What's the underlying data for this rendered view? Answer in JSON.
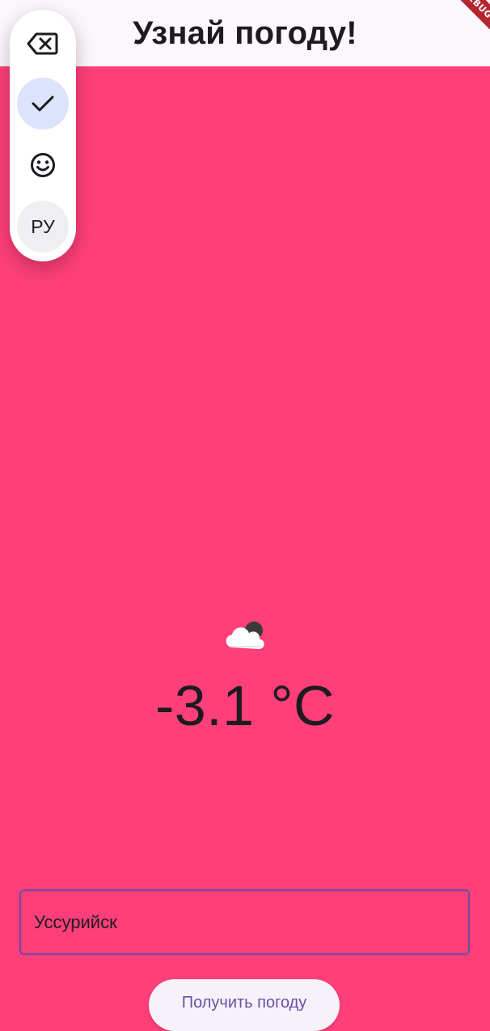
{
  "app_bar": {
    "title": "Узнай погоду!",
    "debug_banner": "DEBUG"
  },
  "side_panel": {
    "buttons": [
      {
        "icon": "backspace-icon"
      },
      {
        "icon": "check-icon",
        "selected": true
      },
      {
        "icon": "emoji-icon"
      },
      {
        "label": "РУ"
      }
    ]
  },
  "weather": {
    "icon": "partly-cloudy-night-icon",
    "temperature": "-3.1 °C"
  },
  "city_input": {
    "value": "Уссурийск"
  },
  "actions": {
    "get_weather_label": "Получить погоду"
  },
  "colors": {
    "background": "#FF3F7A",
    "app_bar": "#FCF7FC",
    "accent": "#6750A4",
    "text": "#1D1B20"
  }
}
